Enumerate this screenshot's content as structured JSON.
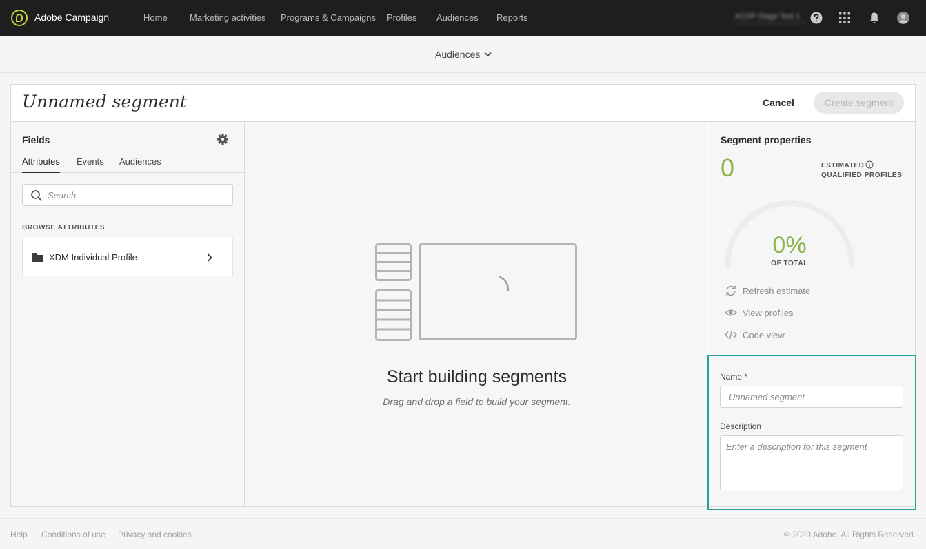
{
  "app": {
    "brand": "Adobe Campaign",
    "org_name": "ACDP Stage Test 1"
  },
  "nav": {
    "items": [
      {
        "label": "Home"
      },
      {
        "label": "Marketing activities"
      },
      {
        "label": "Programs & Campaigns"
      },
      {
        "label": "Profiles"
      },
      {
        "label": "Audiences"
      },
      {
        "label": "Reports"
      }
    ]
  },
  "icons": {
    "help": "help-icon",
    "apps": "apps-grid-icon",
    "notifications": "bell-icon",
    "user": "avatar-icon"
  },
  "subheader": {
    "dropdown_label": "Audiences"
  },
  "segment": {
    "title": "Unnamed segment",
    "cancel_label": "Cancel",
    "create_label": "Create segment"
  },
  "fields_panel": {
    "title": "Fields",
    "tabs": [
      {
        "label": "Attributes",
        "active": true
      },
      {
        "label": "Events"
      },
      {
        "label": "Audiences"
      }
    ],
    "search_placeholder": "Search",
    "browse_label": "BROWSE ATTRIBUTES",
    "items": [
      {
        "label": "XDM Individual Profile"
      }
    ]
  },
  "canvas": {
    "empty_title": "Start building segments",
    "empty_subtitle": "Drag and drop a field to build your segment."
  },
  "properties": {
    "title": "Segment properties",
    "estimate_value": "0",
    "estimate_label_line1": "ESTIMATED",
    "estimate_label_line2": "QUALIFIED PROFILES",
    "percent": "0%",
    "percent_value": 0,
    "percent_label": "OF TOTAL",
    "actions": [
      {
        "label": "Refresh estimate"
      },
      {
        "label": "View profiles"
      },
      {
        "label": "Code view"
      }
    ],
    "name_label": "Name *",
    "name_placeholder": "Unnamed segment",
    "description_label": "Description",
    "description_placeholder": "Enter a description for this segment"
  },
  "colors": {
    "accent_green": "#8cb34a",
    "highlight_teal": "#2aa197",
    "topbar": "#1e1e1e"
  },
  "footer": {
    "links": [
      {
        "label": "Help"
      },
      {
        "label": "Conditions of use"
      },
      {
        "label": "Privacy and cookies"
      }
    ],
    "copyright": "© 2020 Adobe. All Rights Reserved."
  }
}
